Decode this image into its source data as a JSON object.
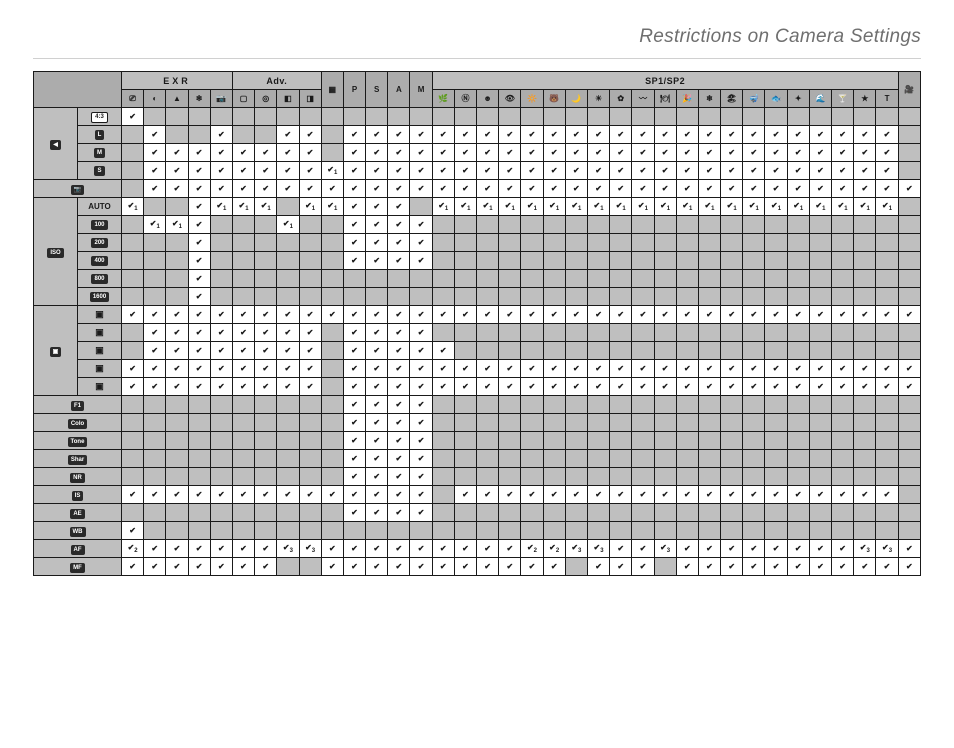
{
  "page": {
    "title": "Restrictions on Camera Settings"
  },
  "groups": {
    "adv": "Adv.",
    "sp": "SP1/SP2",
    "exr": "EXR"
  },
  "cols": [
    "EXR AUTO",
    "DR",
    "HR",
    "SN",
    "Cam",
    "Adv1",
    "Adv2",
    "Adv3",
    "Adv4",
    "PRO",
    "P",
    "S",
    "A",
    "M",
    "Nat",
    "N",
    "Face",
    "Eye",
    "ISO",
    "Bear",
    "Moon",
    "Sun",
    "Flower",
    "Wave",
    "Dish",
    "Party",
    "Snow",
    "Beach",
    "Div",
    "Under",
    "Text",
    "Cust"
  ],
  "rowgroups": [
    {
      "name": "size",
      "label": "◀",
      "rows": [
        {
          "label": "4:3",
          "type": "chipW",
          "marks": [
            "c",
            "",
            "",
            "",
            "",
            "",
            "",
            "",
            "",
            "",
            "",
            "",
            "",
            "",
            "",
            "",
            "",
            "",
            "",
            "",
            "",
            "",
            "",
            "",
            "",
            "",
            "",
            "",
            "",
            "",
            "",
            "",
            "",
            "",
            "",
            ""
          ]
        },
        {
          "label": "L",
          "type": "chip",
          "marks": [
            "",
            "c",
            "",
            "",
            "c",
            "",
            "",
            "c",
            "c",
            "",
            "c",
            "c",
            "c",
            "c",
            "c",
            "c",
            "c",
            "c",
            "c",
            "c",
            "c",
            "c",
            "c",
            "c",
            "c",
            "c",
            "c",
            "c",
            "c",
            "c",
            "c",
            "c",
            "c",
            "c",
            "c",
            ""
          ]
        },
        {
          "label": "M",
          "type": "chip",
          "marks": [
            "",
            "c",
            "c",
            "c",
            "c",
            "c",
            "c",
            "c",
            "c",
            "",
            "c",
            "c",
            "c",
            "c",
            "c",
            "c",
            "c",
            "c",
            "c",
            "c",
            "c",
            "c",
            "c",
            "c",
            "c",
            "c",
            "c",
            "c",
            "c",
            "c",
            "c",
            "c",
            "c",
            "c",
            "c",
            ""
          ]
        },
        {
          "label": "S",
          "type": "chip",
          "marks": [
            "",
            "c",
            "c",
            "c",
            "c",
            "c",
            "c",
            "c",
            "c",
            "c1",
            "c",
            "c",
            "c",
            "c",
            "c",
            "c",
            "c",
            "c",
            "c",
            "c",
            "c",
            "c",
            "c",
            "c",
            "c",
            "c",
            "c",
            "c",
            "c",
            "c",
            "c",
            "c",
            "c",
            "c",
            "c",
            ""
          ]
        }
      ]
    },
    {
      "name": "raw",
      "label": "📷",
      "single": true,
      "marks": [
        "",
        "c",
        "c",
        "c",
        "c",
        "c",
        "c",
        "c",
        "c",
        "c",
        "c",
        "c",
        "c",
        "c",
        "c",
        "c",
        "c",
        "c",
        "c",
        "c",
        "c",
        "c",
        "c",
        "c",
        "c",
        "c",
        "c",
        "c",
        "c",
        "c",
        "c",
        "c",
        "c",
        "c",
        "c",
        "c"
      ]
    },
    {
      "name": "iso",
      "label": "ISO",
      "rows": [
        {
          "label": "AUTO",
          "type": "txt",
          "marks": [
            "c1",
            "",
            "",
            "c",
            "c1",
            "c1",
            "c1",
            "",
            "c1",
            "c1",
            "c",
            "c",
            "c",
            "",
            "c1",
            "c1",
            "c1",
            "c1",
            "c1",
            "c1",
            "c1",
            "c1",
            "c1",
            "c1",
            "c1",
            "c1",
            "c1",
            "c1",
            "c1",
            "c1",
            "c1",
            "c1",
            "c1",
            "c1",
            "c1",
            ""
          ]
        },
        {
          "label": "100",
          "type": "chip",
          "marks": [
            "",
            "c1",
            "c1",
            "c",
            "",
            "",
            "",
            "c1",
            "",
            "",
            "c",
            "c",
            "c",
            "c",
            "",
            "",
            "",
            "",
            "",
            "",
            "",
            "",
            "",
            "",
            "",
            "",
            "",
            "",
            "",
            "",
            "",
            "",
            "",
            "",
            "",
            ""
          ]
        },
        {
          "label": "200",
          "type": "chip",
          "marks": [
            "",
            "",
            "",
            "c",
            "",
            "",
            "",
            "",
            "",
            "",
            "c",
            "c",
            "c",
            "c",
            "",
            "",
            "",
            "",
            "",
            "",
            "",
            "",
            "",
            "",
            "",
            "",
            "",
            "",
            "",
            "",
            "",
            "",
            "",
            "",
            "",
            ""
          ]
        },
        {
          "label": "400",
          "type": "chip",
          "marks": [
            "",
            "",
            "",
            "c",
            "",
            "",
            "",
            "",
            "",
            "",
            "c",
            "c",
            "c",
            "c",
            "",
            "",
            "",
            "",
            "",
            "",
            "",
            "",
            "",
            "",
            "",
            "",
            "",
            "",
            "",
            "",
            "",
            "",
            "",
            "",
            "",
            ""
          ]
        },
        {
          "label": "800",
          "type": "chip",
          "marks": [
            "",
            "",
            "",
            "c",
            "",
            "",
            "",
            "",
            "",
            "",
            "",
            "",
            "",
            "",
            "",
            "",
            "",
            "",
            "",
            "",
            "",
            "",
            "",
            "",
            "",
            "",
            "",
            "",
            "",
            "",
            "",
            "",
            "",
            "",
            "",
            ""
          ]
        },
        {
          "label": "1600",
          "type": "chip",
          "marks": [
            "",
            "",
            "",
            "c",
            "",
            "",
            "",
            "",
            "",
            "",
            "",
            "",
            "",
            "",
            "",
            "",
            "",
            "",
            "",
            "",
            "",
            "",
            "",
            "",
            "",
            "",
            "",
            "",
            "",
            "",
            "",
            "",
            "",
            "",
            "",
            ""
          ]
        }
      ]
    },
    {
      "name": "drive",
      "label": "▣",
      "rows": [
        {
          "label": "d1",
          "type": "ico",
          "marks": [
            "c",
            "c",
            "c",
            "c",
            "c",
            "c",
            "c",
            "c",
            "c",
            "c",
            "c",
            "c",
            "c",
            "c",
            "c",
            "c",
            "c",
            "c",
            "c",
            "c",
            "c",
            "c",
            "c",
            "c",
            "c",
            "c",
            "c",
            "c",
            "c",
            "c",
            "c",
            "c",
            "c",
            "c",
            "c",
            "c"
          ]
        },
        {
          "label": "d2",
          "type": "ico",
          "marks": [
            "",
            "c",
            "c",
            "c",
            "c",
            "c",
            "c",
            "c",
            "c",
            "",
            "c",
            "c",
            "c",
            "c",
            "",
            "",
            "",
            "",
            "",
            "",
            "",
            "",
            "",
            "",
            "",
            "",
            "",
            "",
            "",
            "",
            "",
            "",
            "",
            "",
            "",
            ""
          ]
        },
        {
          "label": "d3",
          "type": "ico",
          "marks": [
            "",
            "c",
            "c",
            "c",
            "c",
            "c",
            "c",
            "c",
            "c",
            "",
            "c",
            "c",
            "c",
            "c",
            "c",
            "",
            "",
            "",
            "",
            "",
            "",
            "",
            "",
            "",
            "",
            "",
            "",
            "",
            "",
            "",
            "",
            "",
            "",
            "",
            "",
            ""
          ]
        },
        {
          "label": "d4",
          "type": "ico",
          "marks": [
            "c",
            "c",
            "c",
            "c",
            "c",
            "c",
            "c",
            "c",
            "c",
            "",
            "c",
            "c",
            "c",
            "c",
            "c",
            "c",
            "c",
            "c",
            "c",
            "c",
            "c",
            "c",
            "c",
            "c",
            "c",
            "c",
            "c",
            "c",
            "c",
            "c",
            "c",
            "c",
            "c",
            "c",
            "c",
            "c"
          ]
        },
        {
          "label": "d5",
          "type": "ico",
          "marks": [
            "c",
            "c",
            "c",
            "c",
            "c",
            "c",
            "c",
            "c",
            "c",
            "",
            "c",
            "c",
            "c",
            "c",
            "c",
            "c",
            "c",
            "c",
            "c",
            "c",
            "c",
            "c",
            "c",
            "c",
            "c",
            "c",
            "c",
            "c",
            "c",
            "c",
            "c",
            "c",
            "c",
            "c",
            "c",
            "c"
          ]
        }
      ]
    },
    {
      "name": "film",
      "label": "F1",
      "single": true,
      "marks": [
        "",
        "",
        "",
        "",
        "",
        "",
        "",
        "",
        "",
        "",
        "c",
        "c",
        "c",
        "c",
        "",
        "",
        "",
        "",
        "",
        "",
        "",
        "",
        "",
        "",
        "",
        "",
        "",
        "",
        "",
        "",
        "",
        "",
        "",
        "",
        "",
        ""
      ]
    },
    {
      "name": "color",
      "label": "Color",
      "single": true,
      "marks": [
        "",
        "",
        "",
        "",
        "",
        "",
        "",
        "",
        "",
        "",
        "c",
        "c",
        "c",
        "c",
        "",
        "",
        "",
        "",
        "",
        "",
        "",
        "",
        "",
        "",
        "",
        "",
        "",
        "",
        "",
        "",
        "",
        "",
        "",
        "",
        "",
        ""
      ]
    },
    {
      "name": "tone",
      "label": "Tone",
      "single": true,
      "marks": [
        "",
        "",
        "",
        "",
        "",
        "",
        "",
        "",
        "",
        "",
        "c",
        "c",
        "c",
        "c",
        "",
        "",
        "",
        "",
        "",
        "",
        "",
        "",
        "",
        "",
        "",
        "",
        "",
        "",
        "",
        "",
        "",
        "",
        "",
        "",
        "",
        ""
      ]
    },
    {
      "name": "sharp",
      "label": "Sharp",
      "single": true,
      "marks": [
        "",
        "",
        "",
        "",
        "",
        "",
        "",
        "",
        "",
        "",
        "c",
        "c",
        "c",
        "c",
        "",
        "",
        "",
        "",
        "",
        "",
        "",
        "",
        "",
        "",
        "",
        "",
        "",
        "",
        "",
        "",
        "",
        "",
        "",
        "",
        "",
        ""
      ]
    },
    {
      "name": "nr",
      "label": "NR",
      "single": true,
      "marks": [
        "",
        "",
        "",
        "",
        "",
        "",
        "",
        "",
        "",
        "",
        "c",
        "c",
        "c",
        "c",
        "",
        "",
        "",
        "",
        "",
        "",
        "",
        "",
        "",
        "",
        "",
        "",
        "",
        "",
        "",
        "",
        "",
        "",
        "",
        "",
        "",
        ""
      ]
    },
    {
      "name": "is",
      "label": "IS",
      "single": true,
      "marks": [
        "c",
        "c",
        "c",
        "c",
        "c",
        "c",
        "c",
        "c",
        "c",
        "c",
        "c",
        "c",
        "c",
        "c",
        "",
        "c",
        "c",
        "c",
        "c",
        "c",
        "c",
        "c",
        "c",
        "c",
        "c",
        "c",
        "c",
        "c",
        "c",
        "c",
        "c",
        "c",
        "c",
        "c",
        "c",
        ""
      ]
    },
    {
      "name": "ae",
      "label": "AE",
      "single": true,
      "marks": [
        "",
        "",
        "",
        "",
        "",
        "",
        "",
        "",
        "",
        "",
        "c",
        "c",
        "c",
        "c",
        "",
        "",
        "",
        "",
        "",
        "",
        "",
        "",
        "",
        "",
        "",
        "",
        "",
        "",
        "",
        "",
        "",
        "",
        "",
        "",
        "",
        ""
      ]
    },
    {
      "name": "wb",
      "label": "WB",
      "single": true,
      "marks": [
        "c",
        "",
        "",
        "",
        "",
        "",
        "",
        "",
        "",
        "",
        "",
        "",
        "",
        "",
        "",
        "",
        "",
        "",
        "",
        "",
        "",
        "",
        "",
        "",
        "",
        "",
        "",
        "",
        "",
        "",
        "",
        "",
        "",
        "",
        "",
        ""
      ]
    },
    {
      "name": "af",
      "label": "AF",
      "single": true,
      "marks": [
        "c2",
        "c",
        "c",
        "c",
        "c",
        "c",
        "c",
        "c3",
        "c3",
        "c",
        "c",
        "c",
        "c",
        "c",
        "c",
        "c",
        "c",
        "c",
        "c2",
        "c2",
        "c3",
        "c3",
        "c",
        "c",
        "c3",
        "c",
        "c",
        "c",
        "c",
        "c",
        "c",
        "c",
        "c",
        "c3",
        "c3",
        "c"
      ]
    },
    {
      "name": "mf",
      "label": "MF",
      "single": true,
      "marks": [
        "c",
        "c",
        "c",
        "c",
        "c",
        "c",
        "c",
        "",
        "",
        "c",
        "c",
        "c",
        "c",
        "c",
        "c",
        "c",
        "c",
        "c",
        "c",
        "c",
        "",
        "c",
        "c",
        "c",
        "",
        "c",
        "c",
        "c",
        "c",
        "c",
        "c",
        "c",
        "c",
        "c",
        "c",
        "c"
      ]
    }
  ],
  "footnotes": {
    "1": "1",
    "2": "2",
    "3": "3"
  },
  "check": "✔"
}
